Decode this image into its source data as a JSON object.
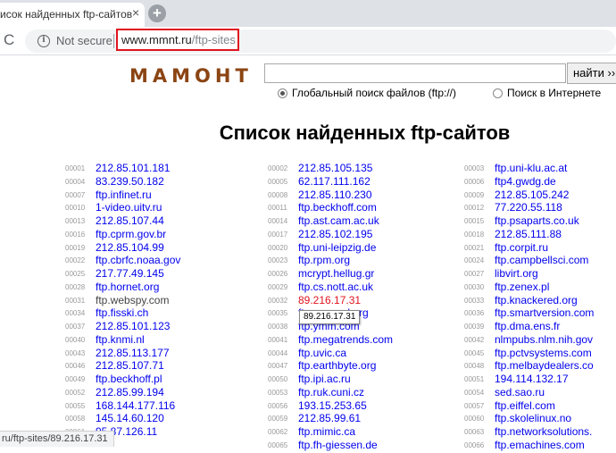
{
  "tab": {
    "title": "исок найденных ftp-сайтов",
    "close": "×",
    "new_tab": "+"
  },
  "toolbar": {
    "reload_glyph": "C",
    "info_glyph": "i",
    "security_text": "Not secure",
    "url_host": "www.mmnt.ru",
    "url_path": "/ftp-sites"
  },
  "header": {
    "logo": "МАМОНТ",
    "search_value": "",
    "search_button": "найти ›››",
    "radio_options": [
      {
        "label": "Глобальный поиск файлов (ftp://)",
        "checked": true
      },
      {
        "label": "Поиск в Интернете",
        "checked": false
      }
    ]
  },
  "page_title": "Список найденных ftp-сайтов",
  "columns": [
    [
      {
        "num": "00001",
        "site": "212.85.101.181"
      },
      {
        "num": "00004",
        "site": "83.239.50.182"
      },
      {
        "num": "00007",
        "site": "ftp.infinet.ru"
      },
      {
        "num": "00010",
        "site": "1-video.uitv.ru"
      },
      {
        "num": "00013",
        "site": "212.85.107.44"
      },
      {
        "num": "00016",
        "site": "ftp.cprm.gov.br"
      },
      {
        "num": "00019",
        "site": "212.85.104.99"
      },
      {
        "num": "00022",
        "site": "ftp.cbrfc.noaa.gov"
      },
      {
        "num": "00025",
        "site": "217.77.49.145"
      },
      {
        "num": "00028",
        "site": "ftp.hornet.org"
      },
      {
        "num": "00031",
        "site": "ftp.webspy.com",
        "style": "gray"
      },
      {
        "num": "00034",
        "site": "ftp.fisski.ch"
      },
      {
        "num": "00037",
        "site": "212.85.101.123"
      },
      {
        "num": "00040",
        "site": "ftp.knmi.nl"
      },
      {
        "num": "00043",
        "site": "212.85.113.177"
      },
      {
        "num": "00046",
        "site": "212.85.107.71"
      },
      {
        "num": "00049",
        "site": "ftp.beckhoff.pl"
      },
      {
        "num": "00052",
        "site": "212.85.99.194"
      },
      {
        "num": "00055",
        "site": "168.144.177.116"
      },
      {
        "num": "00058",
        "site": "145.14.60.120"
      },
      {
        "num": "00061",
        "site": "95.87.126.11"
      }
    ],
    [
      {
        "num": "00002",
        "site": "212.85.105.135"
      },
      {
        "num": "00005",
        "site": "62.117.111.162"
      },
      {
        "num": "00008",
        "site": "212.85.110.230"
      },
      {
        "num": "00011",
        "site": "ftp.beckhoff.com"
      },
      {
        "num": "00014",
        "site": "ftp.ast.cam.ac.uk"
      },
      {
        "num": "00017",
        "site": "212.85.102.195"
      },
      {
        "num": "00020",
        "site": "ftp.uni-leipzig.de"
      },
      {
        "num": "00023",
        "site": "ftp.rpm.org"
      },
      {
        "num": "00026",
        "site": "mcrypt.hellug.gr"
      },
      {
        "num": "00029",
        "site": "ftp.cs.nott.ac.uk"
      },
      {
        "num": "00032",
        "site": "89.216.17.31",
        "style": "red"
      },
      {
        "num": "00035",
        "site": "ftp.openssl.org"
      },
      {
        "num": "00038",
        "site": "ftp.ymm.com"
      },
      {
        "num": "00041",
        "site": "ftp.megatrends.com"
      },
      {
        "num": "00044",
        "site": "ftp.uvic.ca"
      },
      {
        "num": "00047",
        "site": "ftp.earthbyte.org"
      },
      {
        "num": "00050",
        "site": "ftp.ipi.ac.ru"
      },
      {
        "num": "00053",
        "site": "ftp.ruk.cuni.cz"
      },
      {
        "num": "00056",
        "site": "193.15.253.65"
      },
      {
        "num": "00059",
        "site": "212.85.99.61"
      },
      {
        "num": "00062",
        "site": "ftp.mimic.ca"
      },
      {
        "num": "00065",
        "site": "ftp.fh-giessen.de"
      }
    ],
    [
      {
        "num": "00003",
        "site": "ftp.uni-klu.ac.at"
      },
      {
        "num": "00006",
        "site": "ftp4.gwdg.de"
      },
      {
        "num": "00009",
        "site": "212.85.105.242"
      },
      {
        "num": "00012",
        "site": "77.220.55.118"
      },
      {
        "num": "00015",
        "site": "ftp.psaparts.co.uk"
      },
      {
        "num": "00018",
        "site": "212.85.111.88"
      },
      {
        "num": "00021",
        "site": "ftp.corpit.ru"
      },
      {
        "num": "00024",
        "site": "ftp.campbellsci.com"
      },
      {
        "num": "00027",
        "site": "libvirt.org"
      },
      {
        "num": "00030",
        "site": "ftp.zenex.pl"
      },
      {
        "num": "00033",
        "site": "ftp.knackered.org"
      },
      {
        "num": "00036",
        "site": "ftp.smartversion.com"
      },
      {
        "num": "00039",
        "site": "ftp.dma.ens.fr"
      },
      {
        "num": "00042",
        "site": "nlmpubs.nlm.nih.gov"
      },
      {
        "num": "00045",
        "site": "ftp.pctvsystems.com"
      },
      {
        "num": "00048",
        "site": "ftp.melbaydealers.co"
      },
      {
        "num": "00051",
        "site": "194.114.132.17"
      },
      {
        "num": "00054",
        "site": "sed.sao.ru"
      },
      {
        "num": "00057",
        "site": "ftp.eiffel.com"
      },
      {
        "num": "00060",
        "site": "ftp.skolelinux.no"
      },
      {
        "num": "00063",
        "site": "ftp.networksolutions."
      },
      {
        "num": "00066",
        "site": "ftp.emachines.com"
      }
    ]
  ],
  "tooltip": "89.216.17.31",
  "status_bar": "ru/ftp-sites/89.216.17.31"
}
